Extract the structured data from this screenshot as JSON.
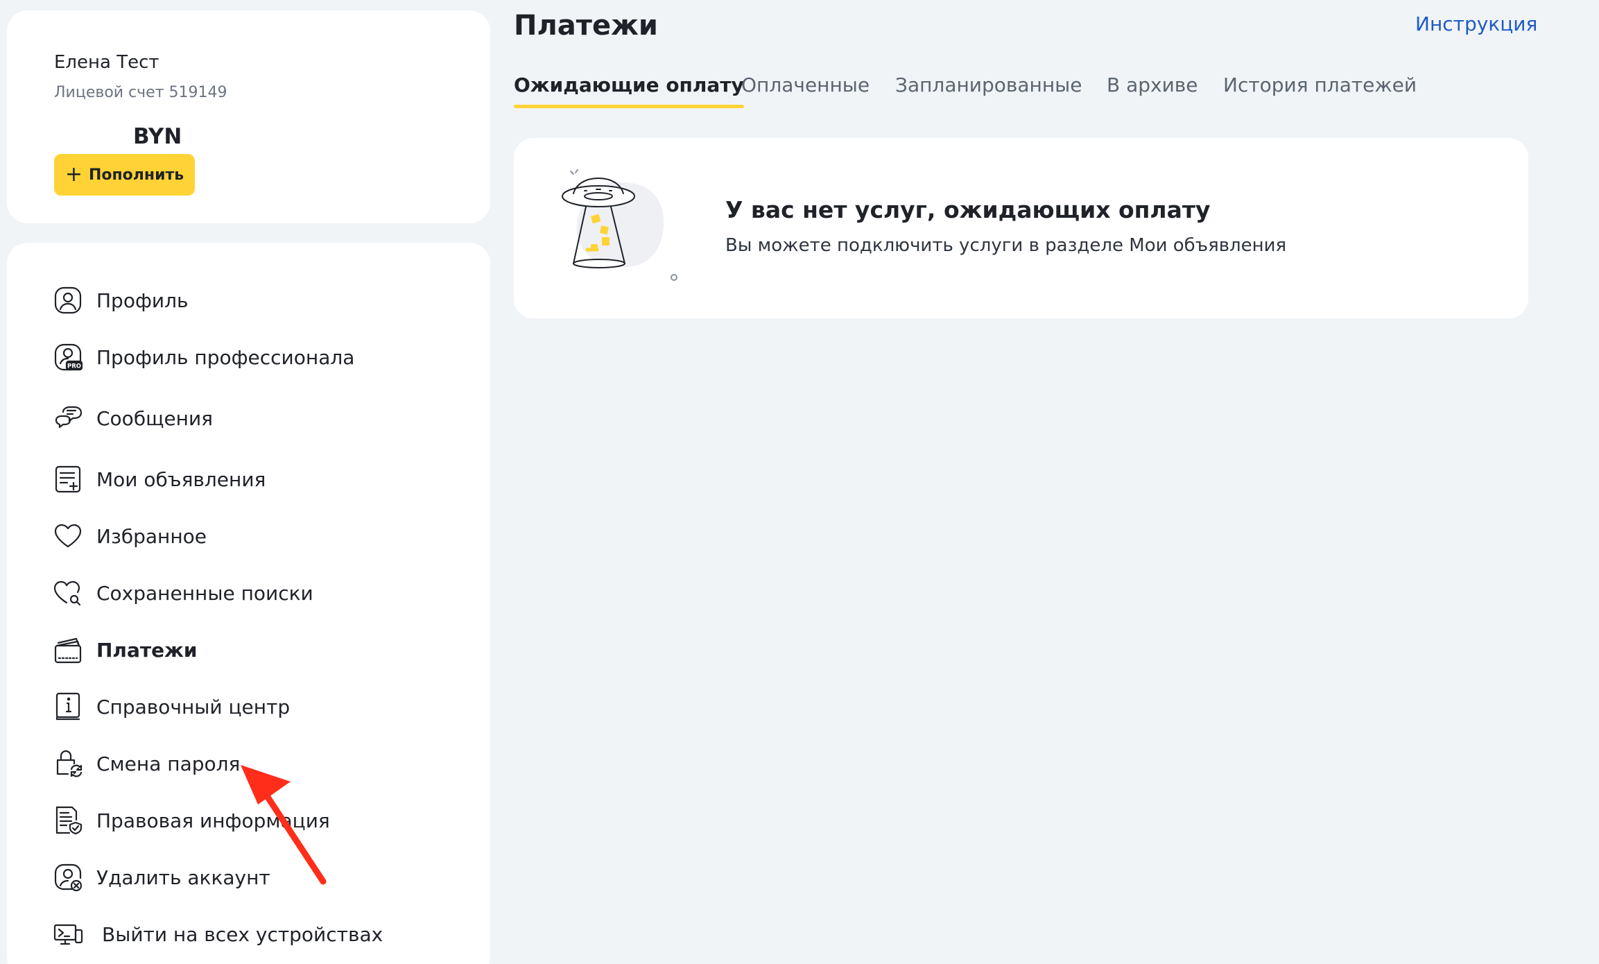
{
  "account": {
    "user_name": "Елена Тест",
    "account_number": "Лицевой счет 519149",
    "balance_currency": "BYN",
    "topup_label": "Пополнить"
  },
  "menu": {
    "items": [
      {
        "label": "Профиль",
        "icon": "profile-icon",
        "active": false
      },
      {
        "label": "Профиль профессионала",
        "icon": "pro-profile-icon",
        "active": false
      },
      {
        "label": "Сообщения",
        "icon": "messages-icon",
        "active": false
      },
      {
        "label": "Мои объявления",
        "icon": "my-ads-icon",
        "active": false
      },
      {
        "label": "Избранное",
        "icon": "favorites-heart-icon",
        "active": false
      },
      {
        "label": "Сохраненные поиски",
        "icon": "saved-searches-icon",
        "active": false
      },
      {
        "label": "Платежи",
        "icon": "payments-wallet-icon",
        "active": true
      },
      {
        "label": "Справочный центр",
        "icon": "help-center-info-icon",
        "active": false
      },
      {
        "label": "Смена пароля",
        "icon": "change-password-lock-icon",
        "active": false
      },
      {
        "label": "Правовая информация",
        "icon": "legal-document-icon",
        "active": false
      },
      {
        "label": "Удалить аккаунт",
        "icon": "delete-account-icon",
        "active": false
      },
      {
        "label": "Выйти на всех устройствах",
        "icon": "logout-devices-icon",
        "active": false
      }
    ]
  },
  "header": {
    "title": "Платежи",
    "instruction_link": "Инструкция"
  },
  "tabs": [
    {
      "label": "Ожидающие оплату",
      "active": true
    },
    {
      "label": "Оплаченные",
      "active": false
    },
    {
      "label": "Запланированные",
      "active": false
    },
    {
      "label": "В архиве",
      "active": false
    },
    {
      "label": "История платежей",
      "active": false
    }
  ],
  "empty_state": {
    "title": "У вас нет услуг, ожидающих оплату",
    "subtitle": "Вы можете подключить услуги в разделе Мои объявления",
    "illustration_icon": "ufo-illustration-icon"
  },
  "colors": {
    "accent": "#ffd335",
    "link": "#1c5bc7",
    "background": "#f1f4f7",
    "annotation": "#ff2d1a"
  }
}
